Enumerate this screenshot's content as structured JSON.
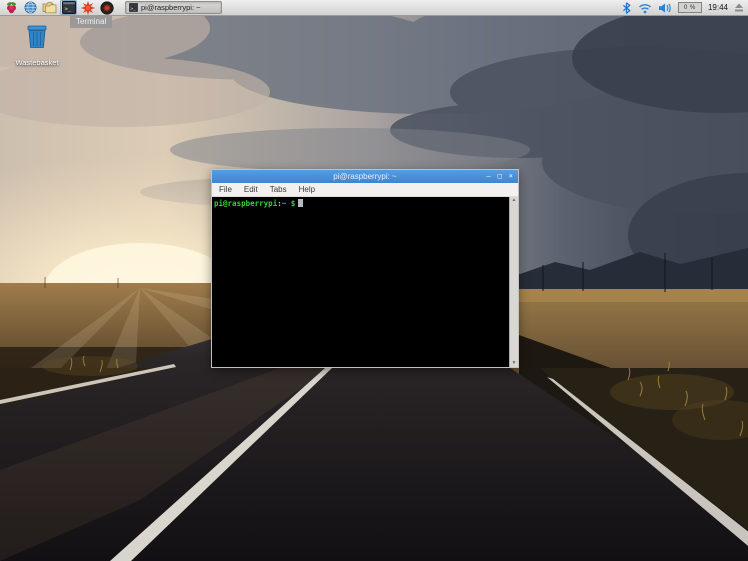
{
  "taskbar": {
    "launcher_tooltip": "Terminal",
    "window_button_label": "pi@raspberrypi: ~",
    "cpu_usage": "0 %",
    "clock": "19:44"
  },
  "desktop": {
    "wastebasket_label": "Wastebasket"
  },
  "terminal_window": {
    "title": "pi@raspberrypi: ~",
    "minimize_glyph": "–",
    "maximize_glyph": "□",
    "close_glyph": "×",
    "menu_items": [
      "File",
      "Edit",
      "Tabs",
      "Help"
    ],
    "prompt_user_host": "pi@raspberrypi",
    "prompt_separator": ":",
    "prompt_path": "~",
    "prompt_symbol": "$"
  },
  "colors": {
    "titlebar_blue": "#4a90d9",
    "panel_gray": "#d8d7d5",
    "prompt_green": "#35d435",
    "prompt_path_blue": "#6f92d8",
    "tray_icon_blue": "#2a82d2"
  }
}
